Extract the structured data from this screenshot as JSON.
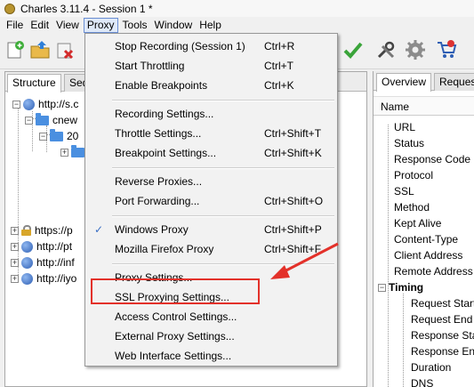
{
  "window": {
    "title": "Charles 3.11.4 - Session 1 *"
  },
  "menubar": [
    "File",
    "Edit",
    "View",
    "Proxy",
    "Tools",
    "Window",
    "Help"
  ],
  "left_tabs": [
    "Structure",
    "Seq"
  ],
  "tree": [
    {
      "label": "http://s.c"
    },
    {
      "label": "cnew"
    },
    {
      "label": "20"
    },
    {
      "label": ""
    },
    {
      "label": "https://p"
    },
    {
      "label": "http://pt"
    },
    {
      "label": "http://inf"
    },
    {
      "label": "http://iyo"
    }
  ],
  "right_tabs": [
    "Overview",
    "Reques"
  ],
  "overview": {
    "column_header": "Name",
    "rows": [
      "URL",
      "Status",
      "Response Code",
      "Protocol",
      "SSL",
      "Method",
      "Kept Alive",
      "Content-Type",
      "Client Address",
      "Remote Address"
    ],
    "timing_label": "Timing",
    "timing_rows": [
      "Request Start",
      "Request End",
      "Response Start",
      "Response End",
      "Duration",
      "DNS"
    ]
  },
  "proxy_menu": {
    "groups": [
      [
        {
          "label": "Stop Recording (Session 1)",
          "shortcut": "Ctrl+R"
        },
        {
          "label": "Start Throttling",
          "shortcut": "Ctrl+T"
        },
        {
          "label": "Enable Breakpoints",
          "shortcut": "Ctrl+K"
        }
      ],
      [
        {
          "label": "Recording Settings...",
          "shortcut": ""
        },
        {
          "label": "Throttle Settings...",
          "shortcut": "Ctrl+Shift+T"
        },
        {
          "label": "Breakpoint Settings...",
          "shortcut": "Ctrl+Shift+K"
        }
      ],
      [
        {
          "label": "Reverse Proxies...",
          "shortcut": ""
        },
        {
          "label": "Port Forwarding...",
          "shortcut": "Ctrl+Shift+O"
        }
      ],
      [
        {
          "label": "Windows Proxy",
          "shortcut": "Ctrl+Shift+P",
          "checked": true
        },
        {
          "label": "Mozilla Firefox Proxy",
          "shortcut": "Ctrl+Shift+F"
        }
      ],
      [
        {
          "label": "Proxy Settings...",
          "shortcut": ""
        },
        {
          "label": "SSL Proxying Settings...",
          "shortcut": ""
        },
        {
          "label": "Access Control Settings...",
          "shortcut": ""
        },
        {
          "label": "External Proxy Settings...",
          "shortcut": ""
        },
        {
          "label": "Web Interface Settings...",
          "shortcut": ""
        }
      ]
    ]
  },
  "check_glyph": "✓",
  "colors": {
    "annotation": "#e3312a",
    "checkmark": "#3a6fc4"
  }
}
